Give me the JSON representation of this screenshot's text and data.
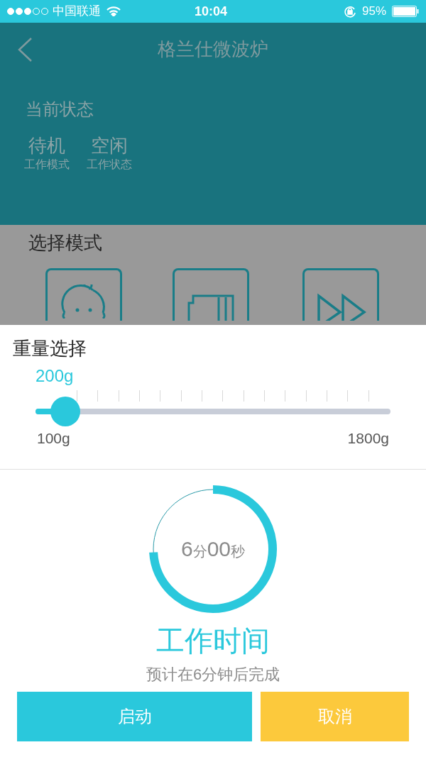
{
  "status_bar": {
    "signal_dots": [
      {
        "filled": true
      },
      {
        "filled": true
      },
      {
        "filled": true
      },
      {
        "filled": false
      },
      {
        "filled": false
      }
    ],
    "carrier": "中国联通",
    "time": "10:04",
    "battery_percent": "95%"
  },
  "header": {
    "title": "格兰仕微波炉"
  },
  "current_state": {
    "title": "当前状态",
    "items": [
      {
        "value": "待机",
        "label": "工作模式"
      },
      {
        "value": "空闲",
        "label": "工作状态"
      }
    ]
  },
  "mode_select": {
    "title": "选择模式",
    "modes": [
      {
        "kind": "baby"
      },
      {
        "kind": "bread"
      },
      {
        "kind": "fast"
      }
    ]
  },
  "weight": {
    "title": "重量选择",
    "value": "200g",
    "level": 0.06,
    "min_label": "100g",
    "max_label": "1800g"
  },
  "timer": {
    "minutes": "6",
    "minute_unit": "分",
    "seconds": "00",
    "second_unit": "秒",
    "title": "工作时间",
    "note": "预计在6分钟后完成"
  },
  "buttons": [
    {
      "kind": "primary",
      "label": "启动"
    },
    {
      "kind": "secondary",
      "label": "取消"
    }
  ]
}
